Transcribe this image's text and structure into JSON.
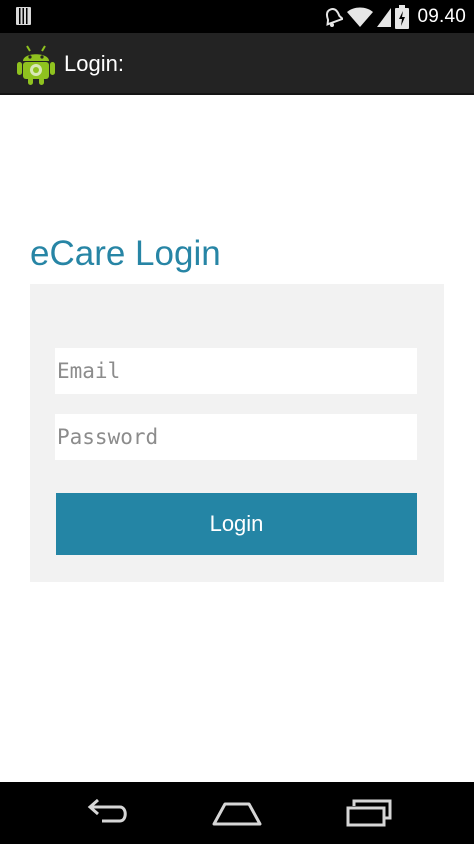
{
  "status_bar": {
    "time": "09.40",
    "icons": [
      "notification-icon",
      "alarm-icon",
      "wifi-icon",
      "signal-icon",
      "battery-icon"
    ]
  },
  "action_bar": {
    "title": "Login:",
    "logo": "android-logo"
  },
  "login_form": {
    "heading": "eCare Login",
    "email_placeholder": "Email",
    "password_placeholder": "Password",
    "login_label": "Login"
  },
  "nav_bar": {
    "icons": [
      "back-icon",
      "home-icon",
      "recents-icon"
    ]
  },
  "colors": {
    "accent": "#2785a5",
    "panel_background": "#f2f2f2",
    "action_bar": "#232323",
    "status_bar": "#000000"
  }
}
